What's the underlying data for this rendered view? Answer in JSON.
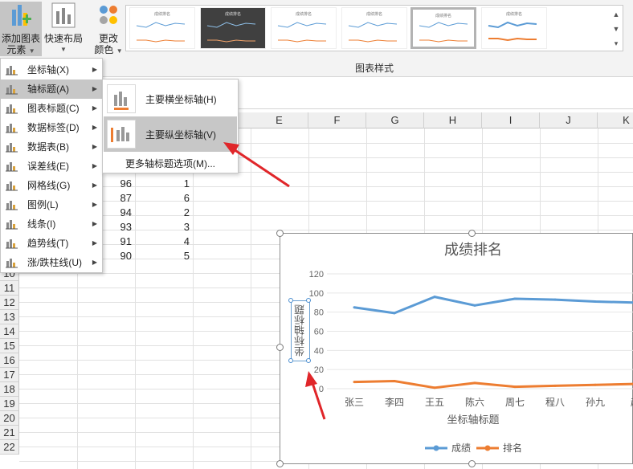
{
  "ribbon": {
    "add_element_line1": "添加图表",
    "add_element_line2": "元素",
    "quick_layout": "快速布局",
    "change_color_line1": "更改",
    "change_color_line2": "颜色",
    "gallery_label": "图表样式",
    "thumb_title": "成绩排名"
  },
  "menu": {
    "items": [
      {
        "label": "坐标轴(X)",
        "icon": "axis-icon"
      },
      {
        "label": "轴标题(A)",
        "icon": "axis-title-icon"
      },
      {
        "label": "图表标题(C)",
        "icon": "chart-title-icon"
      },
      {
        "label": "数据标签(D)",
        "icon": "data-labels-icon"
      },
      {
        "label": "数据表(B)",
        "icon": "data-table-icon"
      },
      {
        "label": "误差线(E)",
        "icon": "error-bars-icon"
      },
      {
        "label": "网格线(G)",
        "icon": "gridlines-icon"
      },
      {
        "label": "图例(L)",
        "icon": "legend-icon"
      },
      {
        "label": "线条(I)",
        "icon": "lines-icon"
      },
      {
        "label": "趋势线(T)",
        "icon": "trendline-icon"
      },
      {
        "label": "涨/跌柱线(U)",
        "icon": "up-down-bars-icon"
      }
    ]
  },
  "submenu": {
    "primary_horizontal": "主要横坐标轴(H)",
    "primary_vertical": "主要纵坐标轴(V)",
    "more_options": "更多轴标题选项(M)..."
  },
  "sheet": {
    "columns": [
      "E",
      "F",
      "G",
      "H",
      "I",
      "J",
      "K"
    ],
    "rows": [
      "10",
      "11",
      "12",
      "13",
      "14",
      "15",
      "16",
      "17",
      "18",
      "19",
      "20",
      "21",
      "22"
    ],
    "col_b_values": [
      "96",
      "87",
      "94",
      "93",
      "91",
      "90"
    ],
    "col_c_values": [
      "1",
      "6",
      "2",
      "3",
      "4",
      "5"
    ]
  },
  "chart_data": {
    "type": "line",
    "title": "成绩排名",
    "categories": [
      "张三",
      "李四",
      "王五",
      "陈六",
      "周七",
      "程八",
      "孙九",
      "赵"
    ],
    "series": [
      {
        "name": "成绩",
        "values": [
          85,
          79,
          96,
          87,
          94,
          93,
          91,
          90
        ],
        "color": "#5b9bd5"
      },
      {
        "name": "排名",
        "values": [
          7,
          8,
          1,
          6,
          2,
          3,
          4,
          5
        ],
        "color": "#ed7d31"
      }
    ],
    "yticks": [
      "0",
      "20",
      "40",
      "60",
      "80",
      "100",
      "120"
    ],
    "ylim": [
      0,
      120
    ],
    "xlabel": "坐标轴标题",
    "ylabel": "坐标轴标题",
    "legend": "bottom"
  }
}
